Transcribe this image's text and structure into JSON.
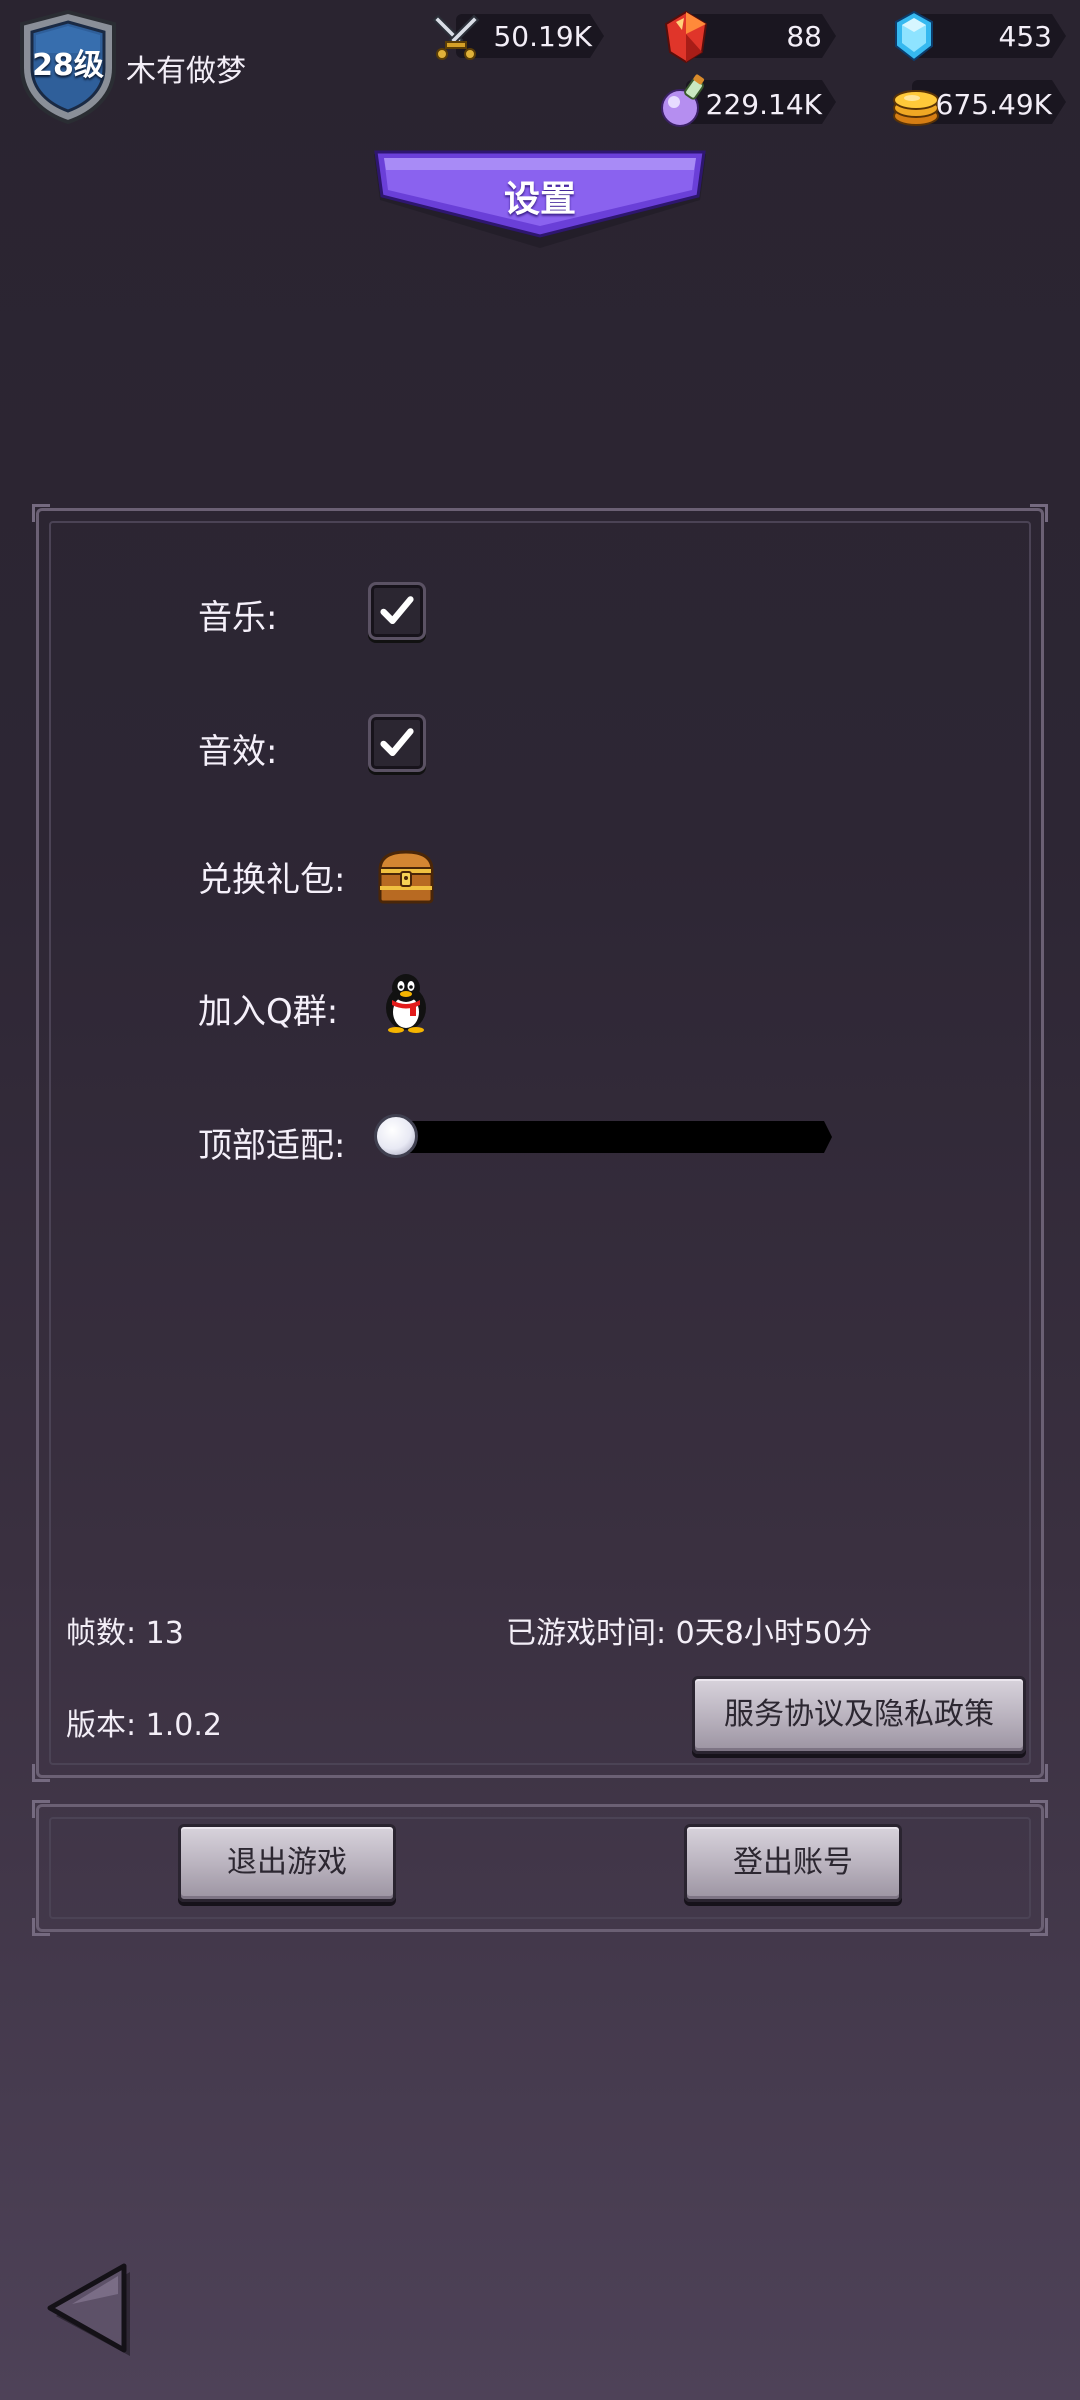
{
  "player": {
    "level": "28级",
    "name": "木有做梦"
  },
  "resources": {
    "power": {
      "value": "50.19K",
      "icon": "crossed-swords-icon"
    },
    "ruby": {
      "value": "88",
      "icon": "red-gem-icon"
    },
    "diamond": {
      "value": "453",
      "icon": "blue-diamond-icon"
    },
    "potion": {
      "value": "229.14K",
      "icon": "potion-flask-icon"
    },
    "gold": {
      "value": "675.49K",
      "icon": "gold-coins-icon"
    }
  },
  "title": "设置",
  "settings": {
    "music_label": "音乐:",
    "music_checked": true,
    "sfx_label": "音效:",
    "sfx_checked": true,
    "gift_label": "兑换礼包:",
    "gift_icon": "treasure-chest-icon",
    "qq_label": "加入Q群:",
    "qq_icon": "qq-penguin-icon",
    "top_adapt_label": "顶部适配:",
    "top_adapt_value": 0
  },
  "info": {
    "fps": "帧数: 13",
    "play_time": "已游戏时间: 0天8小时50分",
    "version": "版本: 1.0.2",
    "privacy_button": "服务协议及隐私政策"
  },
  "actions": {
    "exit_game": "退出游戏",
    "logout": "登出账号"
  },
  "nav": {
    "back_icon": "back-triangle-icon"
  },
  "colors": {
    "background_top": "#2a2430",
    "background_bottom": "#4e4258",
    "title_banner": "#7b52e0",
    "panel_border": "#6b6074",
    "button_stone": "#c6c0ca"
  }
}
